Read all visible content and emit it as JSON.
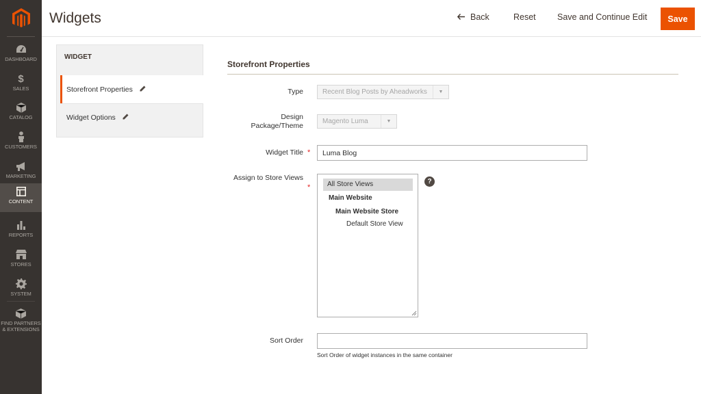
{
  "menu": {
    "items": [
      {
        "label": "DASHBOARD",
        "icon": "dashboard-icon"
      },
      {
        "label": "SALES",
        "icon": "dollar-icon"
      },
      {
        "label": "CATALOG",
        "icon": "cube-icon"
      },
      {
        "label": "CUSTOMERS",
        "icon": "person-icon"
      },
      {
        "label": "MARKETING",
        "icon": "megaphone-icon"
      },
      {
        "label": "CONTENT",
        "icon": "layout-icon"
      },
      {
        "label": "REPORTS",
        "icon": "bar-chart-icon"
      },
      {
        "label": "STORES",
        "icon": "storefront-icon"
      },
      {
        "label": "SYSTEM",
        "icon": "gear-icon"
      },
      {
        "label": "FIND PARTNERS & EXTENSIONS",
        "icon": "box-icon"
      }
    ],
    "active": "CONTENT",
    "accent_color": "#eb5202",
    "bg_color": "#373330"
  },
  "header": {
    "title": "Widgets",
    "back_label": "Back",
    "reset_label": "Reset",
    "save_continue_label": "Save and Continue Edit",
    "save_label": "Save"
  },
  "tabs": {
    "title": "WIDGET",
    "items": [
      {
        "label": "Storefront Properties",
        "active": true
      },
      {
        "label": "Widget Options",
        "active": false
      }
    ]
  },
  "form": {
    "fieldset_title": "Storefront Properties",
    "type": {
      "label": "Type",
      "value": "Recent Blog Posts by Aheadworks"
    },
    "design": {
      "label": "Design Package/Theme",
      "value": "Magento Luma"
    },
    "widget_title": {
      "label": "Widget Title",
      "value": "Luma Blog"
    },
    "store_views": {
      "label": "Assign to Store Views",
      "options": [
        {
          "text": "All Store Views",
          "selected": true
        },
        {
          "text": "Main Website",
          "selected": false
        },
        {
          "text": "Main Website Store",
          "selected": false
        },
        {
          "text": "Default Store View",
          "selected": false
        }
      ],
      "help": "?"
    },
    "sort_order": {
      "label": "Sort Order",
      "value": "",
      "note": "Sort Order of widget instances in the same container"
    }
  }
}
